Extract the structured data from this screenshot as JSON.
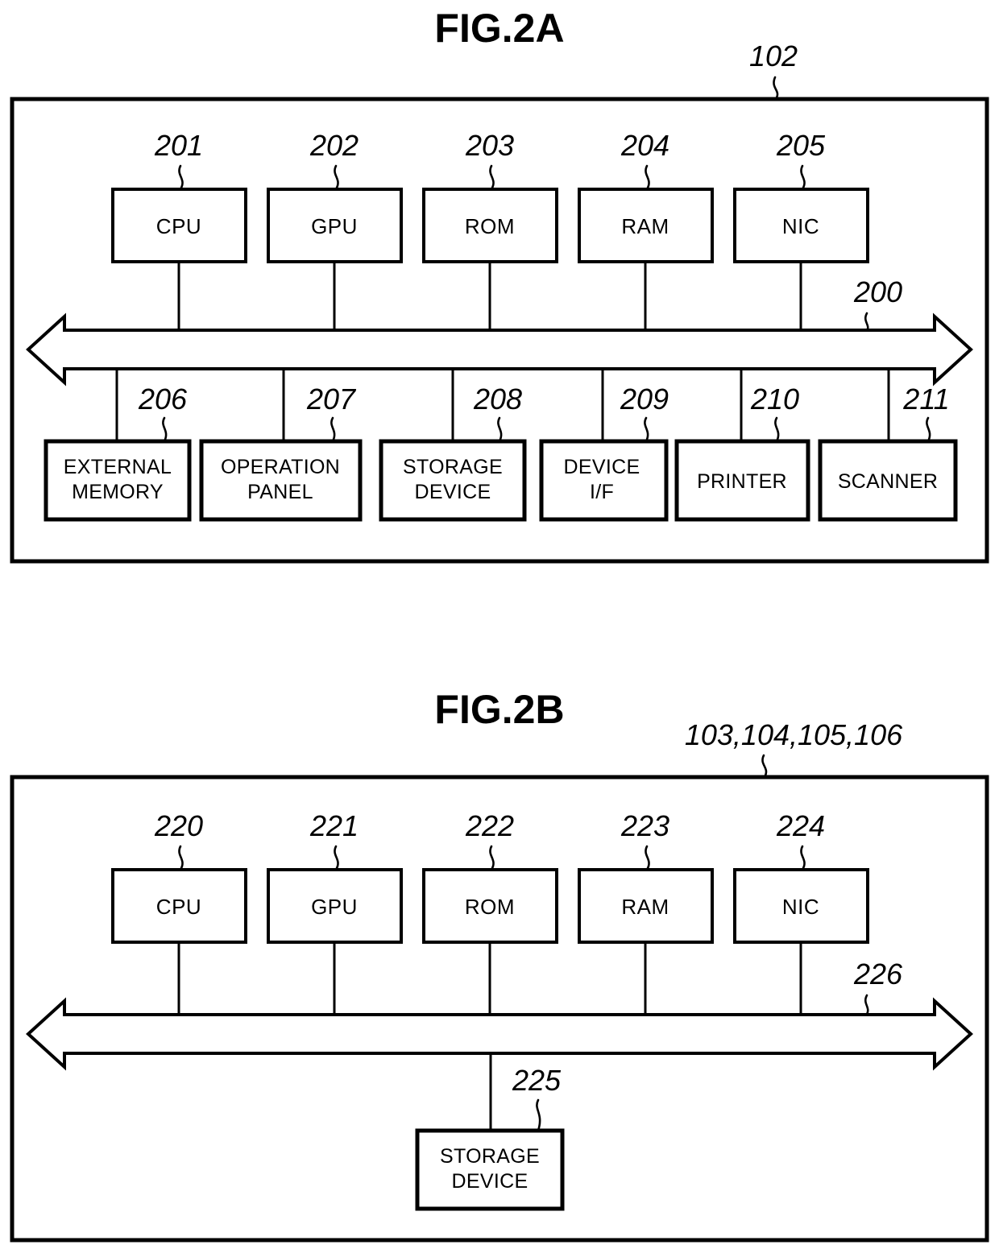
{
  "figures": [
    {
      "id": "fig-2a",
      "title": "FIG.2A",
      "frame_ref": "102",
      "bus_ref": "200",
      "top_row": [
        {
          "ref": "201",
          "label": "CPU"
        },
        {
          "ref": "202",
          "label": "GPU"
        },
        {
          "ref": "203",
          "label": "ROM"
        },
        {
          "ref": "204",
          "label": "RAM"
        },
        {
          "ref": "205",
          "label": "NIC"
        }
      ],
      "bottom_row": [
        {
          "ref": "206",
          "line1": "EXTERNAL",
          "line2": "MEMORY"
        },
        {
          "ref": "207",
          "line1": "OPERATION",
          "line2": "PANEL"
        },
        {
          "ref": "208",
          "line1": "STORAGE",
          "line2": "DEVICE"
        },
        {
          "ref": "209",
          "line1": "DEVICE",
          "line2": "I/F"
        },
        {
          "ref": "210",
          "line1": "PRINTER",
          "line2": ""
        },
        {
          "ref": "211",
          "line1": "SCANNER",
          "line2": ""
        }
      ]
    },
    {
      "id": "fig-2b",
      "title": "FIG.2B",
      "frame_ref": "103,104,105,106",
      "bus_ref": "226",
      "top_row": [
        {
          "ref": "220",
          "label": "CPU"
        },
        {
          "ref": "221",
          "label": "GPU"
        },
        {
          "ref": "222",
          "label": "ROM"
        },
        {
          "ref": "223",
          "label": "RAM"
        },
        {
          "ref": "224",
          "label": "NIC"
        }
      ],
      "bottom_row": [
        {
          "ref": "225",
          "line1": "STORAGE",
          "line2": "DEVICE"
        }
      ]
    }
  ],
  "colors": {
    "ink": "#000000",
    "paper": "#ffffff"
  }
}
